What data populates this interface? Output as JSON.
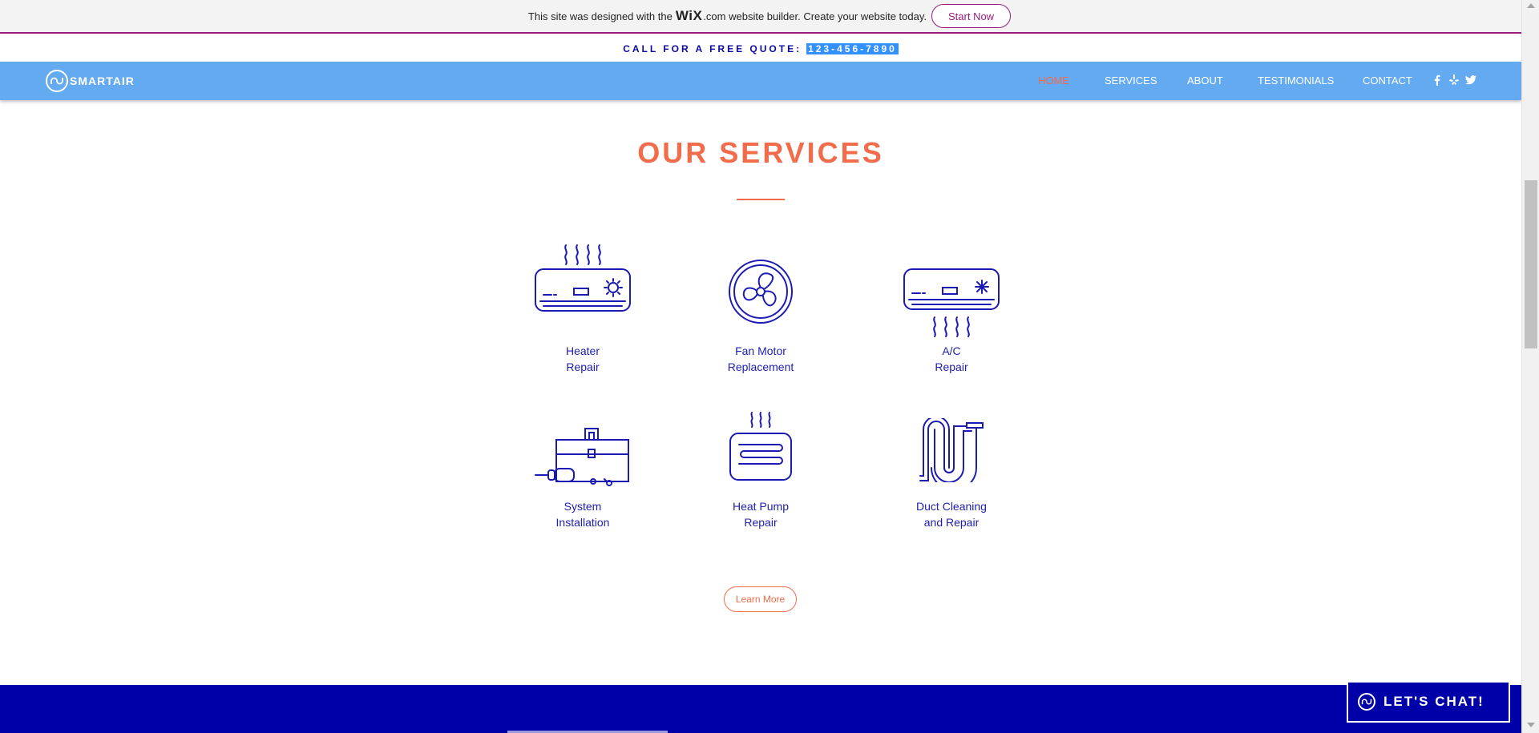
{
  "wix_banner": {
    "text_before": "This site was designed with the",
    "wix": "WiX",
    "text_after": ".com website builder. Create your website today.",
    "start_now": "Start Now",
    "accent": "#9b1b7d"
  },
  "quote_bar": {
    "label": "CALL FOR A FREE QUOTE:",
    "phone": "123-456-7890"
  },
  "nav": {
    "logo_text": "SMARTAIR",
    "items": [
      {
        "label": "HOME",
        "active": true
      },
      {
        "label": "SERVICES"
      },
      {
        "label": "ABOUT"
      },
      {
        "label": "TESTIMONIALS"
      },
      {
        "label": "CONTACT"
      }
    ],
    "social": [
      "facebook-icon",
      "yelp-icon",
      "twitter-icon"
    ],
    "bg": "#63aaf1"
  },
  "services": {
    "title": "OUR SERVICES",
    "items": [
      {
        "line1": "Heater",
        "line2": "Repair",
        "icon": "heater-icon"
      },
      {
        "line1": "Fan Motor",
        "line2": "Replacement",
        "icon": "fan-icon"
      },
      {
        "line1": "A/C",
        "line2": "Repair",
        "icon": "ac-icon"
      },
      {
        "line1": "System",
        "line2": "Installation",
        "icon": "toolbox-icon"
      },
      {
        "line1": "Heat Pump",
        "line2": "Repair",
        "icon": "heat-pump-icon"
      },
      {
        "line1": "Duct Cleaning",
        "line2": "and Repair",
        "icon": "duct-icon"
      }
    ],
    "learn_more": "Learn More",
    "accent": "#f26b4a",
    "icon_color": "#1b1bb3"
  },
  "chat": {
    "label": "LET'S CHAT!"
  }
}
